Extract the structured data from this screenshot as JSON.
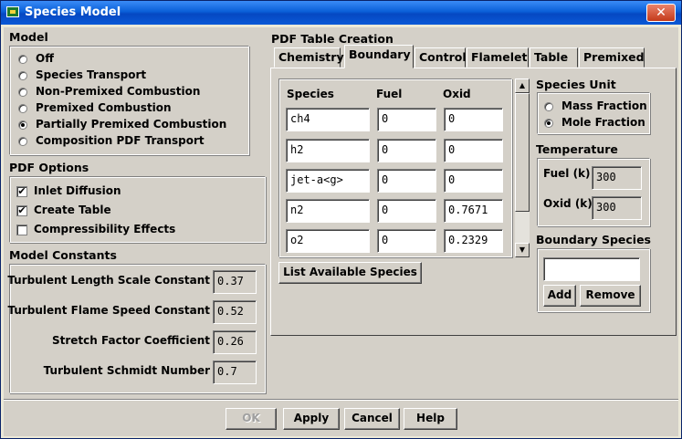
{
  "window": {
    "title": "Species Model",
    "close_glyph": "✕"
  },
  "model": {
    "heading": "Model",
    "options": [
      {
        "label": "Off",
        "selected": false
      },
      {
        "label": "Species Transport",
        "selected": false
      },
      {
        "label": "Non-Premixed Combustion",
        "selected": false
      },
      {
        "label": "Premixed Combustion",
        "selected": false
      },
      {
        "label": "Partially Premixed Combustion",
        "selected": true
      },
      {
        "label": "Composition PDF Transport",
        "selected": false
      }
    ]
  },
  "pdf_options": {
    "heading": "PDF Options",
    "items": [
      {
        "label": "Inlet Diffusion",
        "checked": true
      },
      {
        "label": "Create Table",
        "checked": true
      },
      {
        "label": "Compressibility Effects",
        "checked": false
      }
    ],
    "check_glyph": "✔"
  },
  "model_constants": {
    "heading": "Model Constants",
    "items": [
      {
        "label": "Turbulent Length Scale Constant",
        "value": "0.37"
      },
      {
        "label": "Turbulent Flame Speed Constant",
        "value": "0.52"
      },
      {
        "label": "Stretch Factor Coefficient",
        "value": "0.26"
      },
      {
        "label": "Turbulent Schmidt Number",
        "value": "0.7"
      }
    ]
  },
  "pdf_table": {
    "heading": "PDF Table Creation",
    "tabs": [
      "Chemistry",
      "Boundary",
      "Control",
      "Flamelet",
      "Table",
      "Premixed"
    ],
    "active_tab": "Boundary",
    "species_table": {
      "columns": [
        "Species",
        "Fuel",
        "Oxid"
      ],
      "rows": [
        {
          "species": "ch4",
          "fuel": "0",
          "oxid": "0"
        },
        {
          "species": "h2",
          "fuel": "0",
          "oxid": "0"
        },
        {
          "species": "jet-a<g>",
          "fuel": "0",
          "oxid": "0"
        },
        {
          "species": "n2",
          "fuel": "0",
          "oxid": "0.7671"
        },
        {
          "species": "o2",
          "fuel": "0",
          "oxid": "0.2329"
        }
      ]
    },
    "list_species_label": "List Available Species",
    "scroll_up_glyph": "▲",
    "scroll_down_glyph": "▼",
    "species_unit": {
      "heading": "Species Unit",
      "options": [
        {
          "label": "Mass Fraction",
          "selected": false
        },
        {
          "label": "Mole Fraction",
          "selected": true
        }
      ]
    },
    "temperature": {
      "heading": "Temperature",
      "fuel_label": "Fuel (k)",
      "fuel_value": "300",
      "oxid_label": "Oxid (k)",
      "oxid_value": "300"
    },
    "boundary_species": {
      "heading": "Boundary Species",
      "input_value": "",
      "add_label": "Add",
      "remove_label": "Remove"
    }
  },
  "footer": {
    "ok": "OK",
    "apply": "Apply",
    "cancel": "Cancel",
    "help": "Help"
  }
}
